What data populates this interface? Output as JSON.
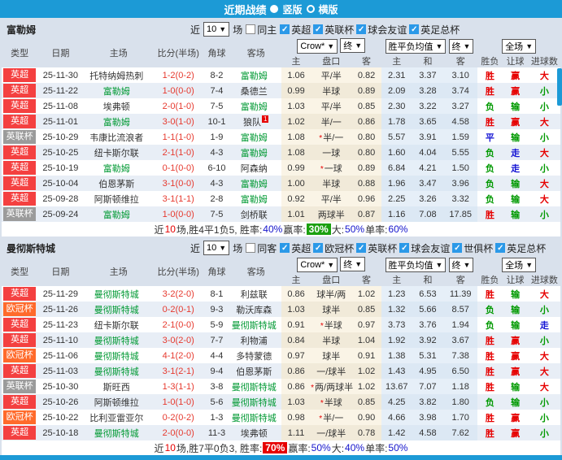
{
  "titlebar": {
    "title": "近期战绩",
    "vertical_label": "竖版",
    "horizontal_label": "横版"
  },
  "icons": {
    "dropdown": "▼",
    "check": "✓"
  },
  "star_mark": "*",
  "filter_labels": {
    "recent": "近",
    "count": "10",
    "games": "场"
  },
  "table_head": {
    "type": "类型",
    "date": "日期",
    "home": "主场",
    "score": "比分(半场)",
    "corner": "角球",
    "away": "客场",
    "odds_source": "Crow*",
    "final1": "终",
    "avg": "胜平负均值",
    "final2": "终",
    "scope": "全场",
    "h": "主",
    "handicap": "盘口",
    "a": "客",
    "w": "主",
    "d": "和",
    "l": "客",
    "result": "胜负",
    "let": "让球",
    "goals": "进球数"
  },
  "league_colors": {
    "英超": "#f44040",
    "英联杯": "#9b9b9b",
    "欧冠杯": "#ff6a2b"
  },
  "result_colors": {
    "胜": "#e60000",
    "负": "#009900",
    "平": "#1414d4",
    "赢": "#e60000",
    "输": "#009900",
    "走": "#1414d4",
    "大": "#e60000",
    "小": "#009900"
  },
  "sections": [
    {
      "team": "富勒姆",
      "same_label": "同主",
      "leagues": [
        "英超",
        "英联杯",
        "球会友谊",
        "英足总杯"
      ],
      "rows": [
        {
          "lg": "英超",
          "dt": "25-11-30",
          "hm": "托特纳姆热刺",
          "hf": 0,
          "hb": "",
          "sc": "1-2(0-2)",
          "cn": "8-2",
          "aw": "富勒姆",
          "af": 1,
          "ab": "",
          "ho": "1.06",
          "pk": "平/半",
          "ps": 0,
          "ao": "0.82",
          "wo": "2.31",
          "dr": "3.37",
          "lo": "3.10",
          "r1": "胜",
          "r2": "赢",
          "r3": "大"
        },
        {
          "lg": "英超",
          "dt": "25-11-22",
          "hm": "富勒姆",
          "hf": 1,
          "hb": "",
          "sc": "1-0(0-0)",
          "cn": "7-4",
          "aw": "桑德兰",
          "af": 0,
          "ab": "",
          "ho": "0.99",
          "pk": "半球",
          "ps": 0,
          "ao": "0.89",
          "wo": "2.09",
          "dr": "3.28",
          "lo": "3.74",
          "r1": "胜",
          "r2": "赢",
          "r3": "小"
        },
        {
          "lg": "英超",
          "dt": "25-11-08",
          "hm": "埃弗顿",
          "hf": 0,
          "hb": "",
          "sc": "2-0(1-0)",
          "cn": "7-5",
          "aw": "富勒姆",
          "af": 1,
          "ab": "",
          "ho": "1.03",
          "pk": "平/半",
          "ps": 0,
          "ao": "0.85",
          "wo": "2.30",
          "dr": "3.22",
          "lo": "3.27",
          "r1": "负",
          "r2": "输",
          "r3": "小"
        },
        {
          "lg": "英超",
          "dt": "25-11-01",
          "hm": "富勒姆",
          "hf": 1,
          "hb": "",
          "sc": "3-0(1-0)",
          "cn": "10-1",
          "aw": "狼队",
          "af": 0,
          "ab": "1",
          "ho": "1.02",
          "pk": "半/一",
          "ps": 0,
          "ao": "0.86",
          "wo": "1.78",
          "dr": "3.65",
          "lo": "4.58",
          "r1": "胜",
          "r2": "赢",
          "r3": "大"
        },
        {
          "lg": "英联杯",
          "dt": "25-10-29",
          "hm": "韦康比流浪者",
          "hf": 0,
          "hb": "",
          "sc": "1-1(1-0)",
          "cn": "1-9",
          "aw": "富勒姆",
          "af": 1,
          "ab": "",
          "ho": "1.08",
          "pk": "半/一",
          "ps": 1,
          "ao": "0.80",
          "wo": "5.57",
          "dr": "3.91",
          "lo": "1.59",
          "r1": "平",
          "r2": "输",
          "r3": "小"
        },
        {
          "lg": "英超",
          "dt": "25-10-25",
          "hm": "纽卡斯尔联",
          "hf": 0,
          "hb": "",
          "sc": "2-1(1-0)",
          "cn": "4-3",
          "aw": "富勒姆",
          "af": 1,
          "ab": "",
          "ho": "1.08",
          "pk": "一球",
          "ps": 0,
          "ao": "0.80",
          "wo": "1.60",
          "dr": "4.04",
          "lo": "5.55",
          "r1": "负",
          "r2": "走",
          "r3": "大"
        },
        {
          "lg": "英超",
          "dt": "25-10-19",
          "hm": "富勒姆",
          "hf": 1,
          "hb": "",
          "sc": "0-1(0-0)",
          "cn": "6-10",
          "aw": "阿森纳",
          "af": 0,
          "ab": "",
          "ho": "0.99",
          "pk": "一球",
          "ps": 1,
          "ao": "0.89",
          "wo": "6.84",
          "dr": "4.21",
          "lo": "1.50",
          "r1": "负",
          "r2": "走",
          "r3": "小"
        },
        {
          "lg": "英超",
          "dt": "25-10-04",
          "hm": "伯恩茅斯",
          "hf": 0,
          "hb": "",
          "sc": "3-1(0-0)",
          "cn": "4-3",
          "aw": "富勒姆",
          "af": 1,
          "ab": "",
          "ho": "1.00",
          "pk": "半球",
          "ps": 0,
          "ao": "0.88",
          "wo": "1.96",
          "dr": "3.47",
          "lo": "3.96",
          "r1": "负",
          "r2": "输",
          "r3": "大"
        },
        {
          "lg": "英超",
          "dt": "25-09-28",
          "hm": "阿斯顿维拉",
          "hf": 0,
          "hb": "",
          "sc": "3-1(1-1)",
          "cn": "2-8",
          "aw": "富勒姆",
          "af": 1,
          "ab": "",
          "ho": "0.92",
          "pk": "平/半",
          "ps": 0,
          "ao": "0.96",
          "wo": "2.25",
          "dr": "3.26",
          "lo": "3.32",
          "r1": "负",
          "r2": "输",
          "r3": "大"
        },
        {
          "lg": "英联杯",
          "dt": "25-09-24",
          "hm": "富勒姆",
          "hf": 1,
          "hb": "",
          "sc": "1-0(0-0)",
          "cn": "7-5",
          "aw": "剑桥联",
          "af": 0,
          "ab": "",
          "ho": "1.01",
          "pk": "两球半",
          "ps": 0,
          "ao": "0.87",
          "wo": "1.16",
          "dr": "7.08",
          "lo": "17.85",
          "r1": "胜",
          "r2": "输",
          "r3": "小"
        }
      ],
      "summary": [
        {
          "t": "近",
          "s": "p"
        },
        {
          "t": "10",
          "s": "r"
        },
        {
          "t": "场,胜4平1负5, 胜率:",
          "s": "p"
        },
        {
          "t": "40%",
          "s": "b"
        },
        {
          "t": " 赢率:",
          "s": "p"
        },
        {
          "t": "30%",
          "s": "gb"
        },
        {
          "t": " 大:",
          "s": "p"
        },
        {
          "t": "50%",
          "s": "b"
        },
        {
          "t": " 单率:",
          "s": "p"
        },
        {
          "t": "60%",
          "s": "b"
        }
      ]
    },
    {
      "team": "曼彻斯特城",
      "same_label": "同客",
      "leagues": [
        "英超",
        "欧冠杯",
        "英联杯",
        "球会友谊",
        "世俱杯",
        "英足总杯"
      ],
      "rows": [
        {
          "lg": "英超",
          "dt": "25-11-29",
          "hm": "曼彻斯特城",
          "hf": 1,
          "hb": "",
          "sc": "3-2(2-0)",
          "cn": "8-1",
          "aw": "利兹联",
          "af": 0,
          "ab": "",
          "ho": "0.86",
          "pk": "球半/两",
          "ps": 0,
          "ao": "1.02",
          "wo": "1.23",
          "dr": "6.53",
          "lo": "11.39",
          "r1": "胜",
          "r2": "输",
          "r3": "大"
        },
        {
          "lg": "欧冠杯",
          "dt": "25-11-26",
          "hm": "曼彻斯特城",
          "hf": 1,
          "hb": "",
          "sc": "0-2(0-1)",
          "cn": "9-3",
          "aw": "勒沃库森",
          "af": 0,
          "ab": "",
          "ho": "1.03",
          "pk": "球半",
          "ps": 0,
          "ao": "0.85",
          "wo": "1.32",
          "dr": "5.66",
          "lo": "8.57",
          "r1": "负",
          "r2": "输",
          "r3": "小"
        },
        {
          "lg": "英超",
          "dt": "25-11-23",
          "hm": "纽卡斯尔联",
          "hf": 0,
          "hb": "",
          "sc": "2-1(0-0)",
          "cn": "5-9",
          "aw": "曼彻斯特城",
          "af": 1,
          "ab": "",
          "ho": "0.91",
          "pk": "半球",
          "ps": 1,
          "ao": "0.97",
          "wo": "3.73",
          "dr": "3.76",
          "lo": "1.94",
          "r1": "负",
          "r2": "输",
          "r3": "走"
        },
        {
          "lg": "英超",
          "dt": "25-11-10",
          "hm": "曼彻斯特城",
          "hf": 1,
          "hb": "",
          "sc": "3-0(2-0)",
          "cn": "7-7",
          "aw": "利物浦",
          "af": 0,
          "ab": "",
          "ho": "0.84",
          "pk": "半球",
          "ps": 0,
          "ao": "1.04",
          "wo": "1.92",
          "dr": "3.92",
          "lo": "3.67",
          "r1": "胜",
          "r2": "赢",
          "r3": "小"
        },
        {
          "lg": "欧冠杯",
          "dt": "25-11-06",
          "hm": "曼彻斯特城",
          "hf": 1,
          "hb": "",
          "sc": "4-1(2-0)",
          "cn": "4-4",
          "aw": "多特蒙德",
          "af": 0,
          "ab": "",
          "ho": "0.97",
          "pk": "球半",
          "ps": 0,
          "ao": "0.91",
          "wo": "1.38",
          "dr": "5.31",
          "lo": "7.38",
          "r1": "胜",
          "r2": "赢",
          "r3": "大"
        },
        {
          "lg": "英超",
          "dt": "25-11-03",
          "hm": "曼彻斯特城",
          "hf": 1,
          "hb": "",
          "sc": "3-1(2-1)",
          "cn": "9-4",
          "aw": "伯恩茅斯",
          "af": 0,
          "ab": "",
          "ho": "0.86",
          "pk": "一/球半",
          "ps": 0,
          "ao": "1.02",
          "wo": "1.43",
          "dr": "4.95",
          "lo": "6.50",
          "r1": "胜",
          "r2": "赢",
          "r3": "大"
        },
        {
          "lg": "英联杯",
          "dt": "25-10-30",
          "hm": "斯旺西",
          "hf": 0,
          "hb": "",
          "sc": "1-3(1-1)",
          "cn": "3-8",
          "aw": "曼彻斯特城",
          "af": 1,
          "ab": "",
          "ho": "0.86",
          "pk": "两/两球半",
          "ps": 1,
          "ao": "1.02",
          "wo": "13.67",
          "dr": "7.07",
          "lo": "1.18",
          "r1": "胜",
          "r2": "输",
          "r3": "大"
        },
        {
          "lg": "英超",
          "dt": "25-10-26",
          "hm": "阿斯顿维拉",
          "hf": 0,
          "hb": "",
          "sc": "1-0(1-0)",
          "cn": "5-6",
          "aw": "曼彻斯特城",
          "af": 1,
          "ab": "",
          "ho": "1.03",
          "pk": "半球",
          "ps": 1,
          "ao": "0.85",
          "wo": "4.25",
          "dr": "3.82",
          "lo": "1.80",
          "r1": "负",
          "r2": "输",
          "r3": "小"
        },
        {
          "lg": "欧冠杯",
          "dt": "25-10-22",
          "hm": "比利亚雷亚尔",
          "hf": 0,
          "hb": "",
          "sc": "0-2(0-2)",
          "cn": "1-3",
          "aw": "曼彻斯特城",
          "af": 1,
          "ab": "",
          "ho": "0.98",
          "pk": "半/一",
          "ps": 1,
          "ao": "0.90",
          "wo": "4.66",
          "dr": "3.98",
          "lo": "1.70",
          "r1": "胜",
          "r2": "赢",
          "r3": "小"
        },
        {
          "lg": "英超",
          "dt": "25-10-18",
          "hm": "曼彻斯特城",
          "hf": 1,
          "hb": "",
          "sc": "2-0(0-0)",
          "cn": "11-3",
          "aw": "埃弗顿",
          "af": 0,
          "ab": "",
          "ho": "1.11",
          "pk": "一/球半",
          "ps": 0,
          "ao": "0.78",
          "wo": "1.42",
          "dr": "4.58",
          "lo": "7.62",
          "r1": "胜",
          "r2": "赢",
          "r3": "小"
        }
      ],
      "summary": [
        {
          "t": "近",
          "s": "p"
        },
        {
          "t": "10",
          "s": "r"
        },
        {
          "t": "场,胜7平0负3, 胜率:",
          "s": "p"
        },
        {
          "t": "70%",
          "s": "rb"
        },
        {
          "t": " 赢率:",
          "s": "p"
        },
        {
          "t": "50%",
          "s": "b"
        },
        {
          "t": " 大:",
          "s": "p"
        },
        {
          "t": "40%",
          "s": "b"
        },
        {
          "t": " 单率:",
          "s": "p"
        },
        {
          "t": "50%",
          "s": "b"
        }
      ]
    }
  ]
}
